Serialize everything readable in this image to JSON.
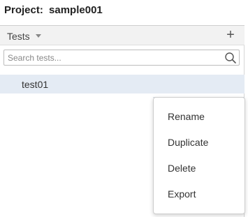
{
  "project": {
    "label": "Project:",
    "name": "sample001"
  },
  "panel": {
    "title": "Tests",
    "add_icon": "plus-icon",
    "search": {
      "placeholder": "Search tests...",
      "value": "",
      "icon": "search-icon"
    },
    "items": [
      {
        "label": "test01",
        "selected": true
      }
    ]
  },
  "context_menu": {
    "items": [
      {
        "label": "Rename"
      },
      {
        "label": "Duplicate"
      },
      {
        "label": "Delete"
      },
      {
        "label": "Export"
      }
    ]
  },
  "colors": {
    "selected_row": "#e4ebf4",
    "toolbar_bg": "#f2f2f2",
    "text": "#333333"
  }
}
